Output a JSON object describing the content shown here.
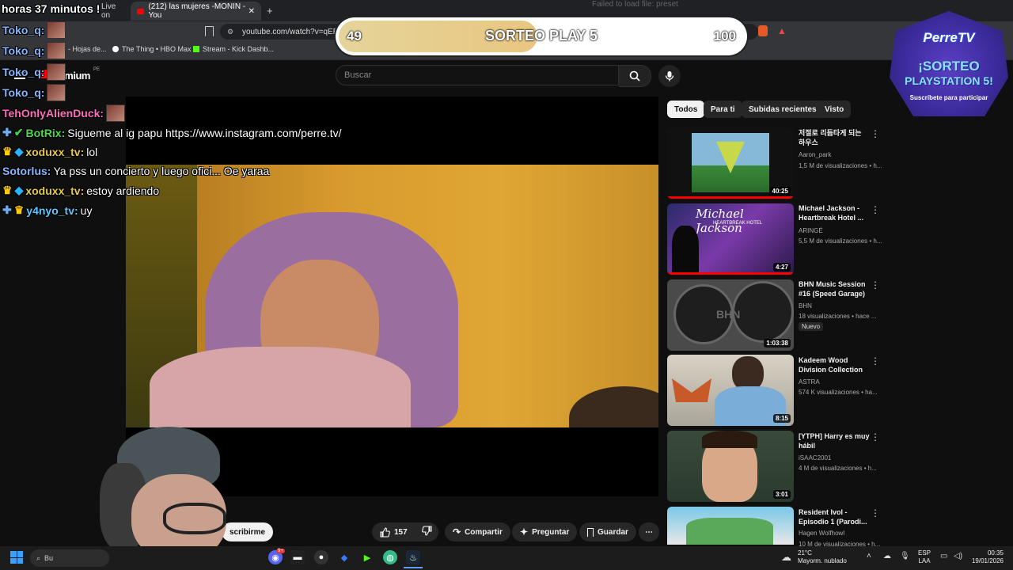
{
  "browser": {
    "tabs": [
      {
        "label": "Live on"
      },
      {
        "label": "(212) las mujeres -MONIN - You"
      }
    ],
    "url": "youtube.com/watch?v=qEEN",
    "bookmarks": [
      {
        "label": "- Hojas de..."
      },
      {
        "label": "The Thing • HBO Max"
      },
      {
        "label": "Stream - Kick Dashb..."
      }
    ],
    "error_text": "Failed to load file: preset"
  },
  "stream_overlay": {
    "timer_text": "horas 37 minutos !",
    "giveaway": {
      "title": "SORTEO PLAY 5",
      "current": "49",
      "goal": "100",
      "progress": 0.49
    },
    "badge": {
      "brand": "PerreTV",
      "line1": "¡SORTEO",
      "line2": "PLAYSTATION 5!",
      "cta": "Suscríbete para participar"
    }
  },
  "chat": [
    {
      "user": "Toko_q:",
      "msg": ""
    },
    {
      "user": "Toko_q:",
      "msg": ""
    },
    {
      "user": "Toko_q:",
      "msg": ""
    },
    {
      "user": "Toko_q:",
      "msg": ""
    },
    {
      "user": "TehOnlyAlienDuck:",
      "msg": ""
    },
    {
      "user": "BotRix:",
      "msg": "Sigueme al ig papu https://www.instagram.com/perre.tv/"
    },
    {
      "user": "xoduxx_tv:",
      "msg": "lol"
    },
    {
      "user": "Sotorlus:",
      "msg": "Ya pss un concierto y luego ofici... Oe yaraa"
    },
    {
      "user": "xoduxx_tv:",
      "msg": "estoy ardiendo"
    },
    {
      "user": "y4nyo_tv:",
      "msg": "uy"
    }
  ],
  "youtube": {
    "logo_text": "remium",
    "region": "PE",
    "search_placeholder": "Buscar",
    "chips": [
      "Todos",
      "Para ti",
      "Subidas recientes",
      "Visto"
    ],
    "actions": {
      "likes": "157",
      "share": "Compartir",
      "ask": "Preguntar",
      "save": "Guardar",
      "subscribe": "scribirme"
    },
    "recommendations": [
      {
        "title": "저절로 리듬타게 되는 하우스",
        "channel": "Aaron_park",
        "meta": "1,5 M de visualizaciones • h...",
        "duration": "40:25",
        "badge": ""
      },
      {
        "title": "Michael Jackson - Heartbreak Hotel ...",
        "channel": "ARINGÉ",
        "meta": "5,5 M de visualizaciones • h...",
        "duration": "4:27",
        "badge": ""
      },
      {
        "title": "BHN Music Session #16 (Speed Garage)",
        "channel": "BHN",
        "meta": "18 visualizaciones • hace ...",
        "duration": "1:03:38",
        "badge": "Nuevo"
      },
      {
        "title": "Kadeem Wood Division Collection",
        "channel": "ASTRA",
        "meta": "574 K visualizaciones • ha...",
        "duration": "8:15",
        "badge": ""
      },
      {
        "title": "[YTPH] Harry es muy hábil",
        "channel": "iSAAC2001",
        "meta": "4 M de visualizaciones • h...",
        "duration": "3:01",
        "badge": ""
      },
      {
        "title": "Resident Ivol - Episodio 1 (Parodi...",
        "channel": "Hagen Wolfhowl",
        "meta": "10 M de visualizaciones • h...",
        "duration": "",
        "badge": ""
      }
    ],
    "thumb_texts": {
      "mj_title": "Michael Jackson",
      "mj_sub": "HEARTBREAK HOTEL",
      "bhn": "BHN"
    }
  },
  "taskbar": {
    "search": "Bu",
    "weather_temp": "21°C",
    "weather_desc": "Mayorm. nublado",
    "lang1": "ESP",
    "lang2": "LAA",
    "time": "00:35",
    "date": "19/01/2026",
    "discord_badge": "9+"
  }
}
